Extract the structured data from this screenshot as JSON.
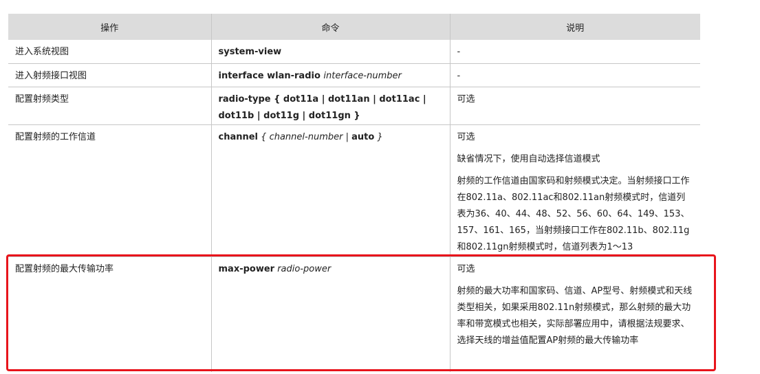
{
  "table": {
    "headers": [
      "操作",
      "命令",
      "说明"
    ],
    "rows": [
      {
        "operation": "进入系统视图",
        "command": [
          {
            "t": "system-view",
            "s": "b"
          }
        ],
        "desc": [
          "-"
        ]
      },
      {
        "operation": "进入射频接口视图",
        "command": [
          {
            "t": "interface wlan-radio ",
            "s": "b"
          },
          {
            "t": "interface-number",
            "s": "i"
          }
        ],
        "desc": [
          "-"
        ]
      },
      {
        "operation": "配置射频类型",
        "command": [
          {
            "t": "radio-type { dot11a | dot11an | dot11ac | dot11b | dot11g | dot11gn }",
            "s": "b"
          }
        ],
        "desc": [
          "可选"
        ]
      },
      {
        "operation": "配置射频的工作信道",
        "command": [
          {
            "t": "channel",
            "s": "b"
          },
          {
            "t": " { ",
            "s": "i"
          },
          {
            "t": "channel-number",
            "s": "i"
          },
          {
            "t": " | ",
            "s": "n"
          },
          {
            "t": "auto",
            "s": "b"
          },
          {
            "t": " }",
            "s": "i"
          }
        ],
        "desc": [
          "可选",
          "缺省情况下，使用自动选择信道模式",
          "射频的工作信道由国家码和射频模式决定。当射频接口工作在802.11a、802.11ac和802.11an射频模式时，信道列表为36、40、44、48、52、56、60、64、149、153、157、161、165，当射频接口工作在802.11b、802.11g和802.11gn射频模式时，信道列表为1～13"
        ]
      },
      {
        "operation": "配置射频的最大传输功率",
        "command": [
          {
            "t": "max-power",
            "s": "b"
          },
          {
            "t": " radio-power",
            "s": "i"
          }
        ],
        "desc": [
          "可选",
          "射频的最大功率和国家码、信道、AP型号、射频模式和天线类型相关，如果采用802.11n射频模式，那么射频的最大功率和带宽模式也相关，实际部署应用中，请根据法规要求、选择天线的增益值配置AP射频的最大传输功率"
        ]
      }
    ]
  },
  "highlight_color": "#e8141b"
}
